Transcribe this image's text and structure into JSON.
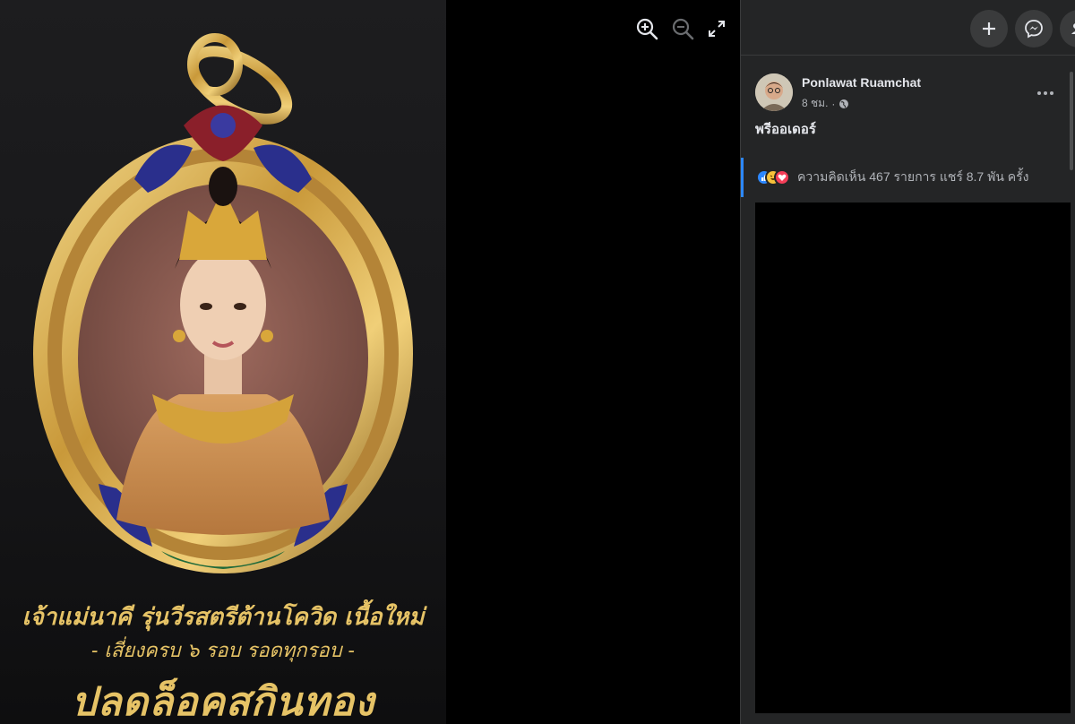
{
  "photo": {
    "caption_line1": "เจ้าแม่นาคี รุ่นวีรสตรีต้านโควิด เนื้อใหม่",
    "caption_line2": "- เสี่ยงครบ ๖ รอบ รอดทุกรอบ -",
    "caption_line3": "ปลดล็อคสกินทอง"
  },
  "viewer_controls": {
    "zoom_in_icon": "zoom-in-icon",
    "zoom_out_icon": "zoom-out-icon",
    "fullscreen_icon": "fullscreen-icon"
  },
  "topbar": {
    "buttons": [
      "plus-icon",
      "messenger-icon",
      "notifications-icon"
    ]
  },
  "post": {
    "author": "Ponlawat Ruamchat",
    "time": "8 ชม.",
    "privacy_icon": "globe-icon",
    "text": "พรีออเดอร์",
    "reaction_icons": [
      "like",
      "haha",
      "love"
    ],
    "stats": "ความคิดเห็น 467 รายการ  แชร์ 8.7 พัน ครั้ง"
  },
  "colors": {
    "accent": "#2d88ff",
    "panel_bg": "#242526",
    "gold_text": "#e6c366"
  }
}
